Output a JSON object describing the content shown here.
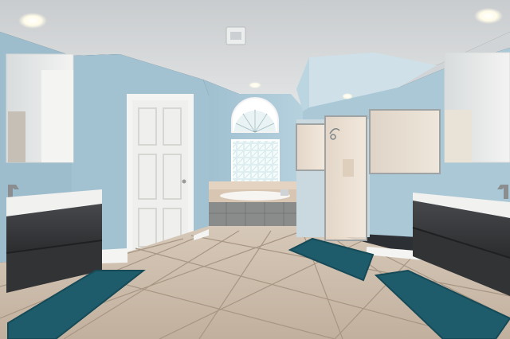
{
  "scene": {
    "kind": "photo",
    "subject": "bathroom-interior",
    "palette": {
      "wall": "#a9c7d6",
      "ceiling": "#d9dcde",
      "floor_tile": "#c9b9a9",
      "grout": "#a8988a",
      "cabinet": "#3a3b3d",
      "countertop": "#eeeeec",
      "rug": "#1f5c6b",
      "door": "#f1f1ef",
      "trim": "#f4f4f2"
    },
    "objects": [
      "recessed-light-icon",
      "ceiling-vent-icon",
      "arched-window-icon",
      "glass-block-window-icon",
      "soaking-tub-icon",
      "interior-door-icon",
      "glass-shower-icon",
      "vanity-cabinet-icon",
      "vanity-mirror-icon",
      "bath-rug-icon",
      "faucet-icon"
    ]
  }
}
